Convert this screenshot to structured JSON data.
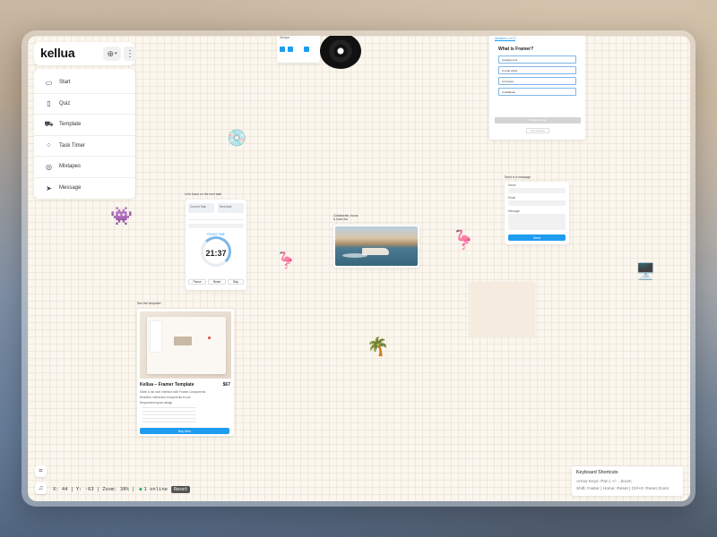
{
  "app": {
    "logo": "kellua"
  },
  "header": {
    "globe_icon": "globe-icon",
    "menu_icon": "more-vertical-icon"
  },
  "sidebar": {
    "items": [
      {
        "label": "Start",
        "icon": "id-card-icon"
      },
      {
        "label": "Quiz",
        "icon": "bookmark-check-icon"
      },
      {
        "label": "Template",
        "icon": "cart-icon"
      },
      {
        "label": "Task Timer",
        "icon": "grid-icon"
      },
      {
        "label": "Mixtapes",
        "icon": "disc-icon"
      },
      {
        "label": "Message",
        "icon": "send-icon"
      }
    ]
  },
  "canvas": {
    "timer_card": {
      "caption": "Let's focus on the next task",
      "current_task_label": "Current Task",
      "next_task_label": "Next task",
      "mode_label": "FOCUS TIME",
      "time": "21:37",
      "buttons": [
        "Pause",
        "Reset",
        "Skip"
      ]
    },
    "template_card": {
      "caption": "See the template!",
      "title": "Kellua – Framer Template",
      "price": "$67",
      "features": [
        "Sleek & fun user interface with Framer Components",
        "Beautiful, interactive components to use",
        "Responsive layout design"
      ],
      "buy_label": "Buy Now"
    },
    "boat_card": {
      "caption": "Collaborate, focus & have fun"
    },
    "message_card": {
      "caption": "Send in a message",
      "name_label": "Name",
      "email_label": "Email",
      "message_label": "Message",
      "send_label": "Send"
    },
    "quiz_card": {
      "tab": "Question 1 of 10",
      "question": "What is Framer?",
      "options": [
        "A design tool",
        "A code editor",
        "A browser",
        "A database"
      ],
      "submit_label": "Check answer",
      "next_label": "Next question"
    },
    "mixtape_card": {
      "caption": "Mixtape"
    }
  },
  "status": {
    "x": "X: 44",
    "y": "Y: -63",
    "zoom": "Zoom: 38%",
    "online": "1 online",
    "reset_label": "Reset"
  },
  "shortcuts": {
    "title": "Keyboard Shortcuts",
    "line1": "Arrow Keys: Pan | +/- : Zoom",
    "line2": "Shift: Faster | Home: Reset | Ctrl+0: Reset Zoom"
  }
}
